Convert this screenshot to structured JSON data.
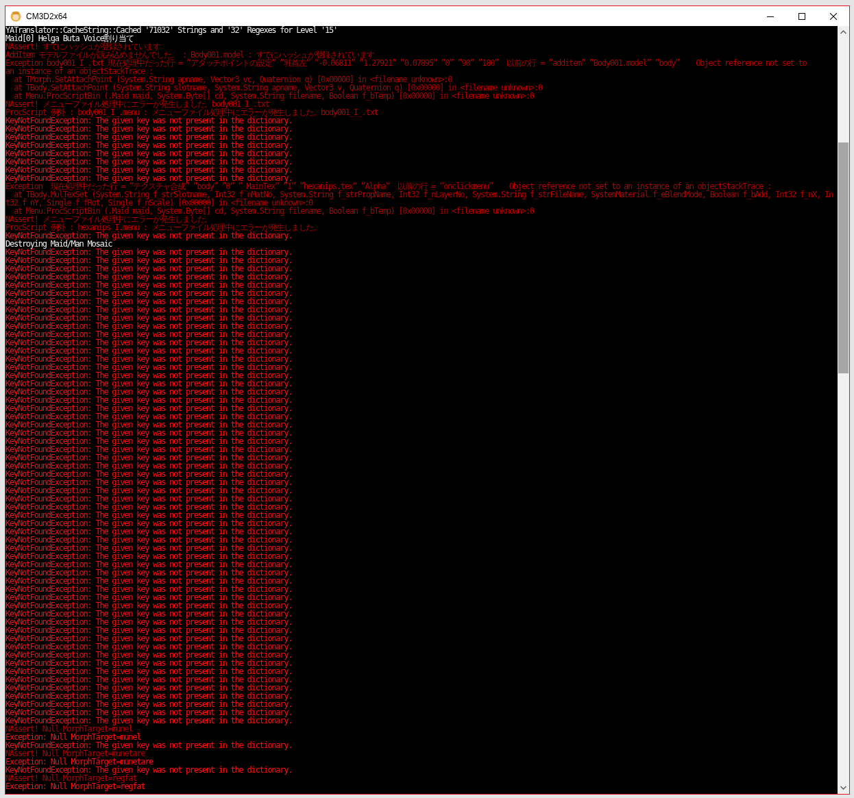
{
  "window": {
    "title": "CM3D2x64"
  },
  "console": {
    "lines": [
      {
        "kind": "info",
        "text": "YATranslator::CacheString::Cached '71032' Strings and '32' Regexes for Level '15'"
      },
      {
        "kind": "info",
        "text": "Maid[0] Helga Buta Voice割り当て"
      },
      {
        "kind": "dim",
        "text": "NAssert! すでにハッシュが登録されています"
      },
      {
        "kind": "dim",
        "text": "AddItem モデルファイルが読み込めませんでした。 : Body001.model : すでにハッシュが登録されています"
      },
      {
        "kind": "dim",
        "text": "Exception body001_I_.txt 現在処理中だった行 = ”アタッチポイントの設定” ”乳首左” ”-0.06811” ”1.27921” ”0.07895” ”0” ”90” ”180”  以前の行 = ”additem” ”Body001.model” ”body”    Object reference not set to"
      },
      {
        "kind": "dim",
        "text": "an instance of an objectStackTrace :"
      },
      {
        "kind": "dim",
        "text": "  at TMorph.SetAttachPoint (System.String apname, Vector3 vc, Quaternion q) [0x00000] in <filename unknown>:0"
      },
      {
        "kind": "dim",
        "text": "  at TBody.SetAttachPoint (System.String slotname, System.String apname, Vector3 v, Quaternion q) [0x00000] in <filename unknown>:0"
      },
      {
        "kind": "dim",
        "text": "  at Menu.ProcScriptBin (.Maid maid, System.Byte[] cd, System.String filename, Boolean f_bTemp) [0x00000] in <filename unknown>:0"
      },
      {
        "kind": "dim",
        "text": "NAssert! メニューファイル処理中にエラーが発生しました。body001_I_.txt"
      },
      {
        "kind": "dim",
        "text": "ProcScript 例外 : body001_I_.menu : メニューファイル処理中にエラーが発生しました。body001_I_.txt"
      },
      {
        "kind": "error",
        "text": "KeyNotFoundException: The given key was not present in the dictionary."
      },
      {
        "kind": "error",
        "text": "KeyNotFoundException: The given key was not present in the dictionary."
      },
      {
        "kind": "error",
        "text": "KeyNotFoundException: The given key was not present in the dictionary."
      },
      {
        "kind": "error",
        "text": "KeyNotFoundException: The given key was not present in the dictionary."
      },
      {
        "kind": "error",
        "text": "KeyNotFoundException: The given key was not present in the dictionary."
      },
      {
        "kind": "error",
        "text": "KeyNotFoundException: The given key was not present in the dictionary."
      },
      {
        "kind": "error",
        "text": "KeyNotFoundException: The given key was not present in the dictionary."
      },
      {
        "kind": "error",
        "text": "KeyNotFoundException: The given key was not present in the dictionary."
      },
      {
        "kind": "dim",
        "text": "Exception  現在処理中だった行 = ”テクスチャ合成” ”body” ”0” ”_MainTex” ”1” ”hexanips.tex” ”Alpha”  以前の行 = ”onclickmenu”    Object reference not set to an instance of an objectStackTrace :"
      },
      {
        "kind": "dim",
        "text": "  at TBody.MulTexSet (System.String f_strSlotname, Int32 f_nMatNo, System.String f_strPropName, Int32 f_nLayerNo, System.String f_strFileName, SystemMaterial f_eBlendMode, Boolean f_bAdd, Int32 f_nX, In"
      },
      {
        "kind": "dim",
        "text": "t32 f_nY, Single f_fRot, Single f_nScale) [0x00000] in <filename unknown>:0"
      },
      {
        "kind": "dim",
        "text": "  at Menu.ProcScriptBin (.Maid maid, System.Byte[] cd, System.String filename, Boolean f_bTemp) [0x00000] in <filename unknown>:0"
      },
      {
        "kind": "dim",
        "text": "NAssert! メニューファイル処理中にエラーが発生しました。"
      },
      {
        "kind": "dim",
        "text": "ProcScript 例外 : hexanips_I.menu : メニューファイル処理中にエラーが発生しました。"
      },
      {
        "kind": "error",
        "text": "KeyNotFoundException: The given key was not present in the dictionary."
      },
      {
        "kind": "info",
        "text": "Destroying Maid/Man Mosaic"
      },
      {
        "kind": "error",
        "text": "KeyNotFoundException: The given key was not present in the dictionary."
      },
      {
        "kind": "error",
        "text": "KeyNotFoundException: The given key was not present in the dictionary."
      },
      {
        "kind": "error",
        "text": "KeyNotFoundException: The given key was not present in the dictionary."
      },
      {
        "kind": "error",
        "text": "KeyNotFoundException: The given key was not present in the dictionary."
      },
      {
        "kind": "error",
        "text": "KeyNotFoundException: The given key was not present in the dictionary."
      },
      {
        "kind": "error",
        "text": "KeyNotFoundException: The given key was not present in the dictionary."
      },
      {
        "kind": "error",
        "text": "KeyNotFoundException: The given key was not present in the dictionary."
      },
      {
        "kind": "error",
        "text": "KeyNotFoundException: The given key was not present in the dictionary."
      },
      {
        "kind": "error",
        "text": "KeyNotFoundException: The given key was not present in the dictionary."
      },
      {
        "kind": "error",
        "text": "KeyNotFoundException: The given key was not present in the dictionary."
      },
      {
        "kind": "error",
        "text": "KeyNotFoundException: The given key was not present in the dictionary."
      },
      {
        "kind": "error",
        "text": "KeyNotFoundException: The given key was not present in the dictionary."
      },
      {
        "kind": "error",
        "text": "KeyNotFoundException: The given key was not present in the dictionary."
      },
      {
        "kind": "error",
        "text": "KeyNotFoundException: The given key was not present in the dictionary."
      },
      {
        "kind": "error",
        "text": "KeyNotFoundException: The given key was not present in the dictionary."
      },
      {
        "kind": "error",
        "text": "KeyNotFoundException: The given key was not present in the dictionary."
      },
      {
        "kind": "error",
        "text": "KeyNotFoundException: The given key was not present in the dictionary."
      },
      {
        "kind": "error",
        "text": "KeyNotFoundException: The given key was not present in the dictionary."
      },
      {
        "kind": "error",
        "text": "KeyNotFoundException: The given key was not present in the dictionary."
      },
      {
        "kind": "error",
        "text": "KeyNotFoundException: The given key was not present in the dictionary."
      },
      {
        "kind": "error",
        "text": "KeyNotFoundException: The given key was not present in the dictionary."
      },
      {
        "kind": "error",
        "text": "KeyNotFoundException: The given key was not present in the dictionary."
      },
      {
        "kind": "error",
        "text": "KeyNotFoundException: The given key was not present in the dictionary."
      },
      {
        "kind": "error",
        "text": "KeyNotFoundException: The given key was not present in the dictionary."
      },
      {
        "kind": "error",
        "text": "KeyNotFoundException: The given key was not present in the dictionary."
      },
      {
        "kind": "error",
        "text": "KeyNotFoundException: The given key was not present in the dictionary."
      },
      {
        "kind": "error",
        "text": "KeyNotFoundException: The given key was not present in the dictionary."
      },
      {
        "kind": "error",
        "text": "KeyNotFoundException: The given key was not present in the dictionary."
      },
      {
        "kind": "error",
        "text": "KeyNotFoundException: The given key was not present in the dictionary."
      },
      {
        "kind": "error",
        "text": "KeyNotFoundException: The given key was not present in the dictionary."
      },
      {
        "kind": "error",
        "text": "KeyNotFoundException: The given key was not present in the dictionary."
      },
      {
        "kind": "error",
        "text": "KeyNotFoundException: The given key was not present in the dictionary."
      },
      {
        "kind": "error",
        "text": "KeyNotFoundException: The given key was not present in the dictionary."
      },
      {
        "kind": "error",
        "text": "KeyNotFoundException: The given key was not present in the dictionary."
      },
      {
        "kind": "error",
        "text": "KeyNotFoundException: The given key was not present in the dictionary."
      },
      {
        "kind": "error",
        "text": "KeyNotFoundException: The given key was not present in the dictionary."
      },
      {
        "kind": "error",
        "text": "KeyNotFoundException: The given key was not present in the dictionary."
      },
      {
        "kind": "error",
        "text": "KeyNotFoundException: The given key was not present in the dictionary."
      },
      {
        "kind": "error",
        "text": "KeyNotFoundException: The given key was not present in the dictionary."
      },
      {
        "kind": "error",
        "text": "KeyNotFoundException: The given key was not present in the dictionary."
      },
      {
        "kind": "error",
        "text": "KeyNotFoundException: The given key was not present in the dictionary."
      },
      {
        "kind": "error",
        "text": "KeyNotFoundException: The given key was not present in the dictionary."
      },
      {
        "kind": "error",
        "text": "KeyNotFoundException: The given key was not present in the dictionary."
      },
      {
        "kind": "error",
        "text": "KeyNotFoundException: The given key was not present in the dictionary."
      },
      {
        "kind": "error",
        "text": "KeyNotFoundException: The given key was not present in the dictionary."
      },
      {
        "kind": "error",
        "text": "KeyNotFoundException: The given key was not present in the dictionary."
      },
      {
        "kind": "error",
        "text": "KeyNotFoundException: The given key was not present in the dictionary."
      },
      {
        "kind": "error",
        "text": "KeyNotFoundException: The given key was not present in the dictionary."
      },
      {
        "kind": "error",
        "text": "KeyNotFoundException: The given key was not present in the dictionary."
      },
      {
        "kind": "error",
        "text": "KeyNotFoundException: The given key was not present in the dictionary."
      },
      {
        "kind": "error",
        "text": "KeyNotFoundException: The given key was not present in the dictionary."
      },
      {
        "kind": "error",
        "text": "KeyNotFoundException: The given key was not present in the dictionary."
      },
      {
        "kind": "error",
        "text": "KeyNotFoundException: The given key was not present in the dictionary."
      },
      {
        "kind": "error",
        "text": "KeyNotFoundException: The given key was not present in the dictionary."
      },
      {
        "kind": "error",
        "text": "KeyNotFoundException: The given key was not present in the dictionary."
      },
      {
        "kind": "error",
        "text": "KeyNotFoundException: The given key was not present in the dictionary."
      },
      {
        "kind": "error",
        "text": "KeyNotFoundException: The given key was not present in the dictionary."
      },
      {
        "kind": "error",
        "text": "KeyNotFoundException: The given key was not present in the dictionary."
      },
      {
        "kind": "dim",
        "text": "NAssert! Null MorphTarget=munel"
      },
      {
        "kind": "error",
        "text": "Exception: Null MorphTarget=munel"
      },
      {
        "kind": "error",
        "text": "KeyNotFoundException: The given key was not present in the dictionary."
      },
      {
        "kind": "dim",
        "text": "NAssert! Null MorphTarget=munetare"
      },
      {
        "kind": "error",
        "text": "Exception: Null MorphTarget=munetare"
      },
      {
        "kind": "error",
        "text": "KeyNotFoundException: The given key was not present in the dictionary."
      },
      {
        "kind": "dim",
        "text": "NAssert! Null MorphTarget=regfat"
      },
      {
        "kind": "error",
        "text": "Exception: Null MorphTarget=regfat"
      }
    ]
  }
}
